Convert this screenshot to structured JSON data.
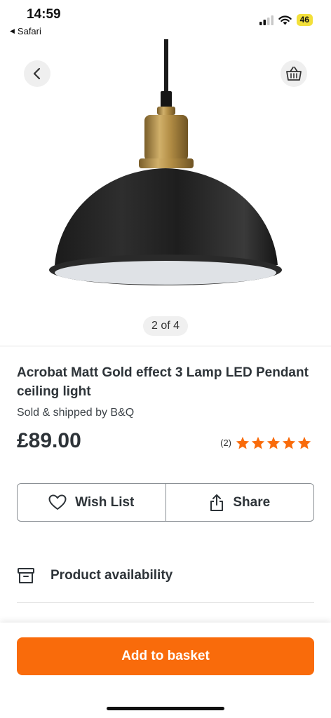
{
  "status_bar": {
    "time": "14:59",
    "back_app": "Safari",
    "battery": "46"
  },
  "gallery": {
    "pager": "2 of 4"
  },
  "product": {
    "title": "Acrobat Matt Gold effect 3 Lamp LED Pendant ceiling light",
    "sold_by": "Sold & shipped by B&Q",
    "price": "£89.00",
    "review_count": "(2)",
    "rating": 5,
    "rating_max": 5
  },
  "actions": {
    "wishlist_label": "Wish List",
    "share_label": "Share"
  },
  "availability": {
    "label": "Product availability"
  },
  "cta": {
    "add_to_basket": "Add to basket"
  },
  "colors": {
    "accent": "#f96b0b",
    "star": "#f96b0b"
  },
  "icons": [
    "back-chevron-icon",
    "basket-icon",
    "heart-icon",
    "share-icon",
    "archive-box-icon",
    "star-icon"
  ]
}
